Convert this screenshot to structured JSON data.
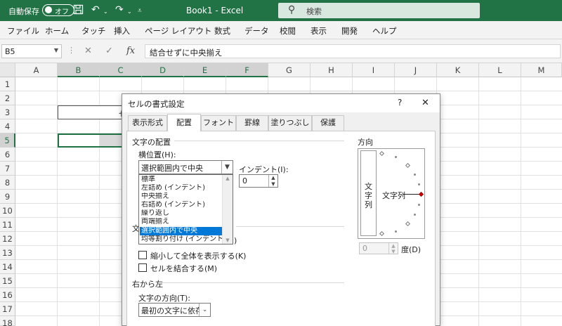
{
  "titlebar": {
    "autosave_label": "自動保存",
    "autosave_toggle": "オフ",
    "doc_title": "Book1 - Excel",
    "search_placeholder": "検索",
    "icons": [
      "save-icon",
      "undo-icon",
      "redo-icon",
      "customize-quick-access-icon",
      "search-icon"
    ]
  },
  "ribbon": {
    "tabs": [
      "ファイル",
      "ホーム",
      "タッチ",
      "挿入",
      "ページ レイアウト",
      "数式",
      "データ",
      "校閲",
      "表示",
      "開発",
      "ヘルプ"
    ]
  },
  "formula_bar": {
    "name_box": "B5",
    "cancel_symbol": "✕",
    "enter_symbol": "✓",
    "fx_symbol": "fx",
    "value": "結合せずに中央揃え"
  },
  "sheet": {
    "columns": [
      "A",
      "B",
      "C",
      "D",
      "E",
      "F",
      "G",
      "H",
      "I",
      "J",
      "K",
      "L",
      "M"
    ],
    "rows": [
      "1",
      "2",
      "3",
      "4",
      "5",
      "6",
      "7",
      "8",
      "9",
      "10",
      "11",
      "12",
      "13",
      "14",
      "15",
      "16",
      "17",
      "18"
    ],
    "cell_b3_visible_text": "セ",
    "selected_cell": "B5"
  },
  "dialog": {
    "title": "セルの書式設定",
    "help_button": "?",
    "close_button": "✕",
    "tabs": [
      "表示形式",
      "配置",
      "フォント",
      "罫線",
      "塗りつぶし",
      "保護"
    ],
    "active_tab": "配置",
    "text_alignment_group": "文字の配置",
    "horizontal_label": "横位置(H):",
    "horizontal_value": "選択範囲内で中央",
    "indent_label": "インデント(I):",
    "indent_value": "0",
    "horizontal_options": [
      "標準",
      "左詰め (インデント)",
      "中央揃え",
      "右詰め (インデント)",
      "繰り返し",
      "両端揃え",
      "選択範囲内で中央",
      "均等割り付け (インデント)"
    ],
    "highlighted_option": "選択範囲内で中央",
    "text_control_group_partial": "文",
    "wrap_partial_tail": ")",
    "shrink_to_fit_label": "縮小して全体を表示する(K)",
    "merge_cells_label": "セルを結合する(M)",
    "rtl_group": "右から左",
    "text_direction_label": "文字の方向(T):",
    "text_direction_value": "最初の文字に依存",
    "orientation_group": "方向",
    "vertical_text": "文字列",
    "orientation_text": "文字列",
    "degrees_value": "0",
    "degrees_label": "度(D)"
  },
  "colors": {
    "excel_green": "#217346",
    "selection_blue": "#0078d7"
  }
}
